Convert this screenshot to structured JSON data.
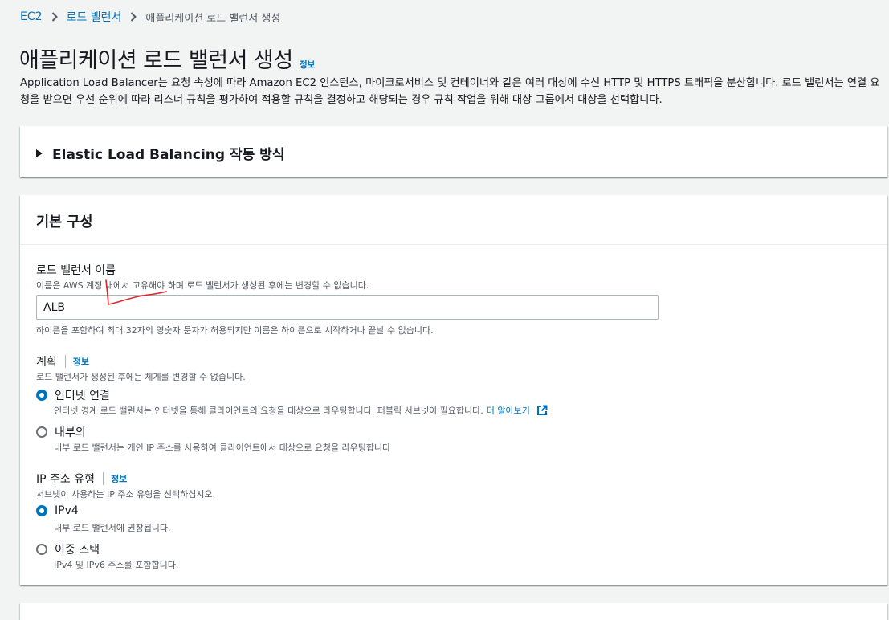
{
  "breadcrumb": {
    "items": [
      "EC2",
      "로드 밸런서"
    ],
    "current": "애플리케이션 로드 밸런서 생성"
  },
  "header": {
    "title": "애플리케이션 로드 밸런서 생성",
    "info": "정보",
    "description": "Application Load Balancer는 요청 속성에 따라 Amazon EC2 인스턴스, 마이크로서비스 및 컨테이너와 같은 여러 대상에 수신 HTTP 및 HTTPS 트래픽을 분산합니다. 로드 밸런서는 연결 요청을 받으면 우선 순위에 따라 리스너 규칙을 평가하여 적용할 규칙을 결정하고 해당되는 경우 규칙 작업을 위해 대상 그룹에서 대상을 선택합니다."
  },
  "how_it_works": {
    "title": "Elastic Load Balancing 작동 방식"
  },
  "basic_config": {
    "title": "기본 구성",
    "name_field": {
      "label": "로드 밸런서 이름",
      "description": "이름은 AWS 계정 내에서 고유해야 하며 로드 밸런서가 생성된 후에는 변경할 수 없습니다.",
      "value": "ALB",
      "constraint": "하이픈을 포함하여 최대 32자의 영숫자 문자가 허용되지만 이름은 하이픈으로 시작하거나 끝날 수 없습니다."
    },
    "scheme": {
      "label": "계획",
      "info": "정보",
      "description": "로드 밸런서가 생성된 후에는 체계를 변경할 수 없습니다.",
      "options": [
        {
          "label": "인터넷 연결",
          "description": "인터넷 경계 로드 밸런서는 인터넷을 통해 클라이언트의 요청을 대상으로 라우팅합니다. 퍼블릭 서브넷이 필요합니다.",
          "link": "더 알아보기",
          "selected": true
        },
        {
          "label": "내부의",
          "description": "내부 로드 밸런서는 개인 IP 주소를 사용하여 클라이언트에서 대상으로 요청을 라우팅합니다",
          "selected": false
        }
      ]
    },
    "ip_type": {
      "label": "IP 주소 유형",
      "info": "정보",
      "description": "서브넷이 사용하는 IP 주소 유형을 선택하십시오.",
      "options": [
        {
          "label": "IPv4",
          "description": "내부 로드 밸런서에 권장됩니다.",
          "selected": true
        },
        {
          "label": "이중 스택",
          "description": "IPv4 및 IPv6 주소를 포함합니다.",
          "selected": false
        }
      ]
    }
  },
  "colors": {
    "accent": "#0073bb",
    "background": "#f2f3f3",
    "annotation": "#e0252b"
  }
}
